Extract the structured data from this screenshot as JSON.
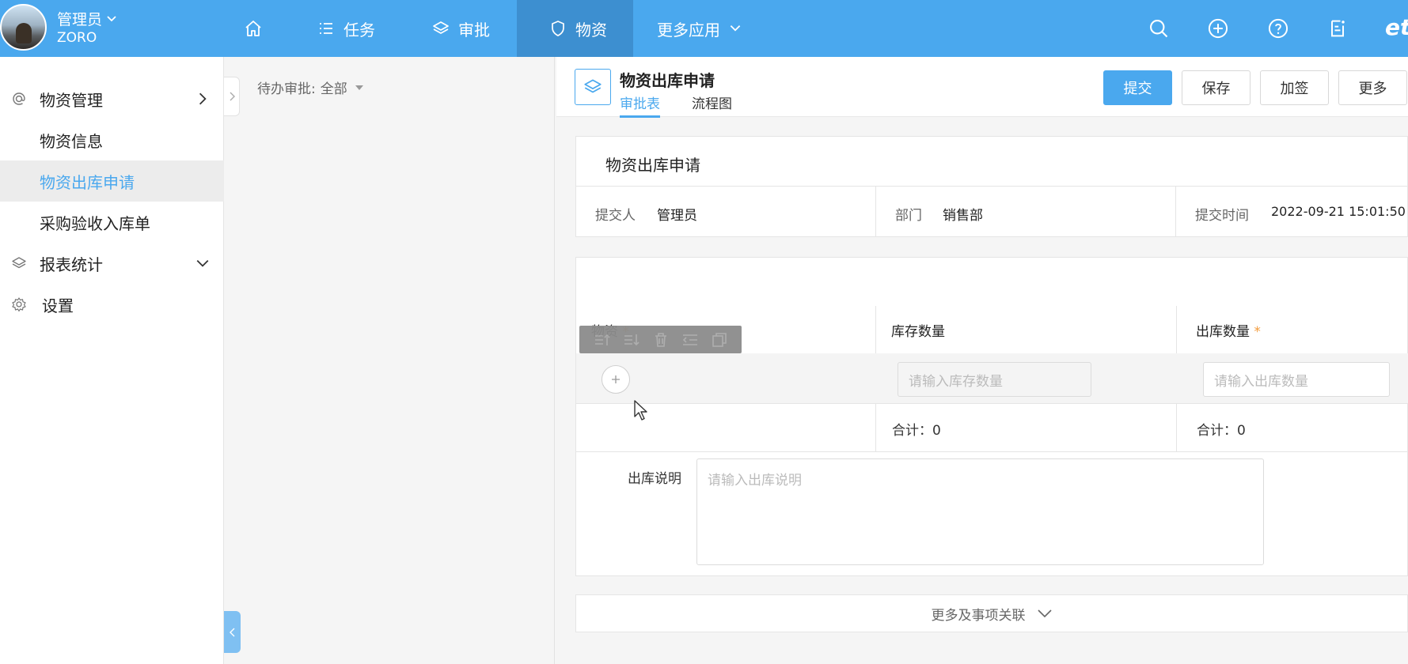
{
  "user": {
    "name": "管理员",
    "sub": "ZORO"
  },
  "nav": {
    "items": [
      {
        "label": "任务",
        "icon": "list-icon"
      },
      {
        "label": "审批",
        "icon": "layers-icon"
      },
      {
        "label": "物资",
        "icon": "shield-icon"
      },
      {
        "label": "更多应用",
        "icon": "chevron-down-icon"
      }
    ],
    "brand": "et"
  },
  "sidebar": {
    "items": [
      {
        "label": "物资管理",
        "icon": "at-icon"
      },
      {
        "label": "物资信息"
      },
      {
        "label": "物资出库申请"
      },
      {
        "label": "采购验收入库单"
      },
      {
        "label": "报表统计",
        "icon": "layers-icon"
      },
      {
        "label": "设置",
        "icon": "gear-icon"
      }
    ]
  },
  "list": {
    "filter_label": "待办审批:",
    "filter_value": "全部"
  },
  "doc": {
    "title": "物资出库申请",
    "tabs": [
      "审批表",
      "流程图"
    ],
    "buttons": [
      "提交",
      "保存",
      "加签",
      "更多"
    ]
  },
  "form": {
    "title": "物资出库申请",
    "submitter_label": "提交人",
    "submitter_value": "管理员",
    "dept_label": "部门",
    "dept_value": "销售部",
    "time_label": "提交时间",
    "time_value": "2022-09-21 15:01:50",
    "table": {
      "col_item": "物资",
      "col_stock": "库存数量",
      "col_out": "出库数量",
      "stock_placeholder": "请输入库存数量",
      "out_placeholder": "请输入出库数量",
      "sum_stock": "合计：0",
      "sum_out": "合计：0",
      "required_mark": "*"
    },
    "desc_label": "出库说明",
    "desc_placeholder": "请输入出库说明",
    "more_link": "更多及事项关联"
  },
  "colors": {
    "primary": "#4aa8ee",
    "nav_active": "#3d8fd0",
    "required": "#f39c3d"
  }
}
